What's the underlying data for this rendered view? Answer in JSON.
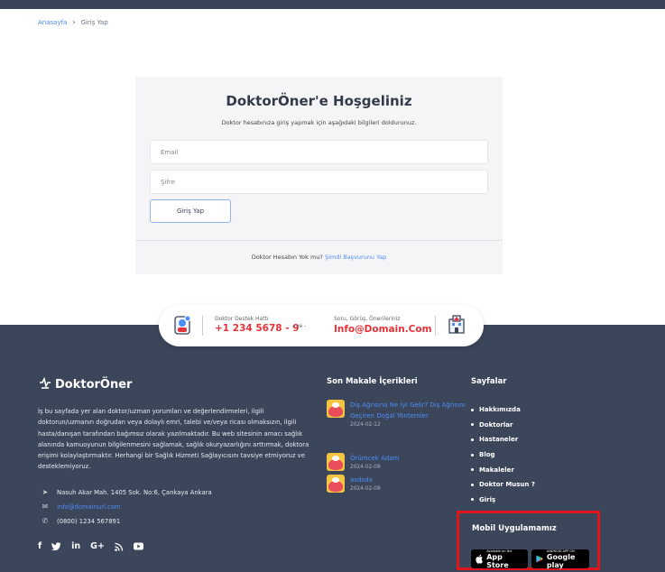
{
  "breadcrumb": {
    "home": "Anasayfa",
    "separator": "›",
    "current": "Giriş Yap"
  },
  "login": {
    "title": "DoktorÖner'e Hoşgeliniz",
    "subtitle": "Doktor hesabınıza giriş yapmak için aşağıdaki bilgileri doldurunuz.",
    "email_placeholder": "Email",
    "password_placeholder": "Şifre",
    "submit_label": "Giriş Yap",
    "no_account_text": "Doktor Hesabın Yok mu?",
    "apply_link": "Şimdi Başvurunu Yap"
  },
  "contact_bar": {
    "support_label": "Doktor Destek Hattı",
    "phone": "+1 234 5678 - 9",
    "separator": "- ve -",
    "suggest_label": "Soru, Görüş, Önerileriniz",
    "email": "Info@Domain.Com"
  },
  "footer": {
    "logo": "DoktorÖner",
    "about": "İş bu sayfada yer alan doktor/uzman yorumları ve değerlendirmeleri, ilgili doktorun/uzmanın doğrudan veya dolaylı emri, talebi ve/veya ricası olmaksızın, ilgili hasta/danışan tarafından bağımsız olarak yazılmaktadır. Bu web sitesinin amacı sağlık alanında kamuoyunun bilgilenmesini sağlamak, sağlık okuryazarlığını arttırmak, doktora erişimi kolaylaştırmaktır. Herhangi bir Sağlık Hizmeti Sağlayıcısını tavsiye etmiyoruz ve desteklemiyoruz.",
    "address": "Nasuh Akar Mah. 1405 Sok. No:6, Çankaya Ankara",
    "email": "info@domainurl.com",
    "phone": "(0800) 1234 567891",
    "social": [
      "f",
      "𝕪",
      "in",
      "G+",
      "rss",
      "yt"
    ],
    "articles_title": "Son Makale İçerikleri",
    "articles": [
      {
        "title": "Diş Ağrısına Ne İyi Gelir? Diş Ağrısını Geçiren Doğal Yöntemler",
        "date": "2024-02-12"
      },
      {
        "title": "Örümcek Adam",
        "date": "2024-02-08"
      },
      {
        "title": "asdsda",
        "date": "2024-02-08"
      }
    ],
    "pages_title": "Sayfalar",
    "pages": [
      "Hakkımızda",
      "Doktorlar",
      "Hastaneler",
      "Blog",
      "Makaleler",
      "Doktor Musun ?",
      "Giriş"
    ],
    "mobile_title": "Mobil Uygulamamız",
    "app_store_small": "Available on the",
    "app_store_big": "App Store",
    "google_play_small": "ANDROID APP ON",
    "google_play_big": "Google play"
  }
}
